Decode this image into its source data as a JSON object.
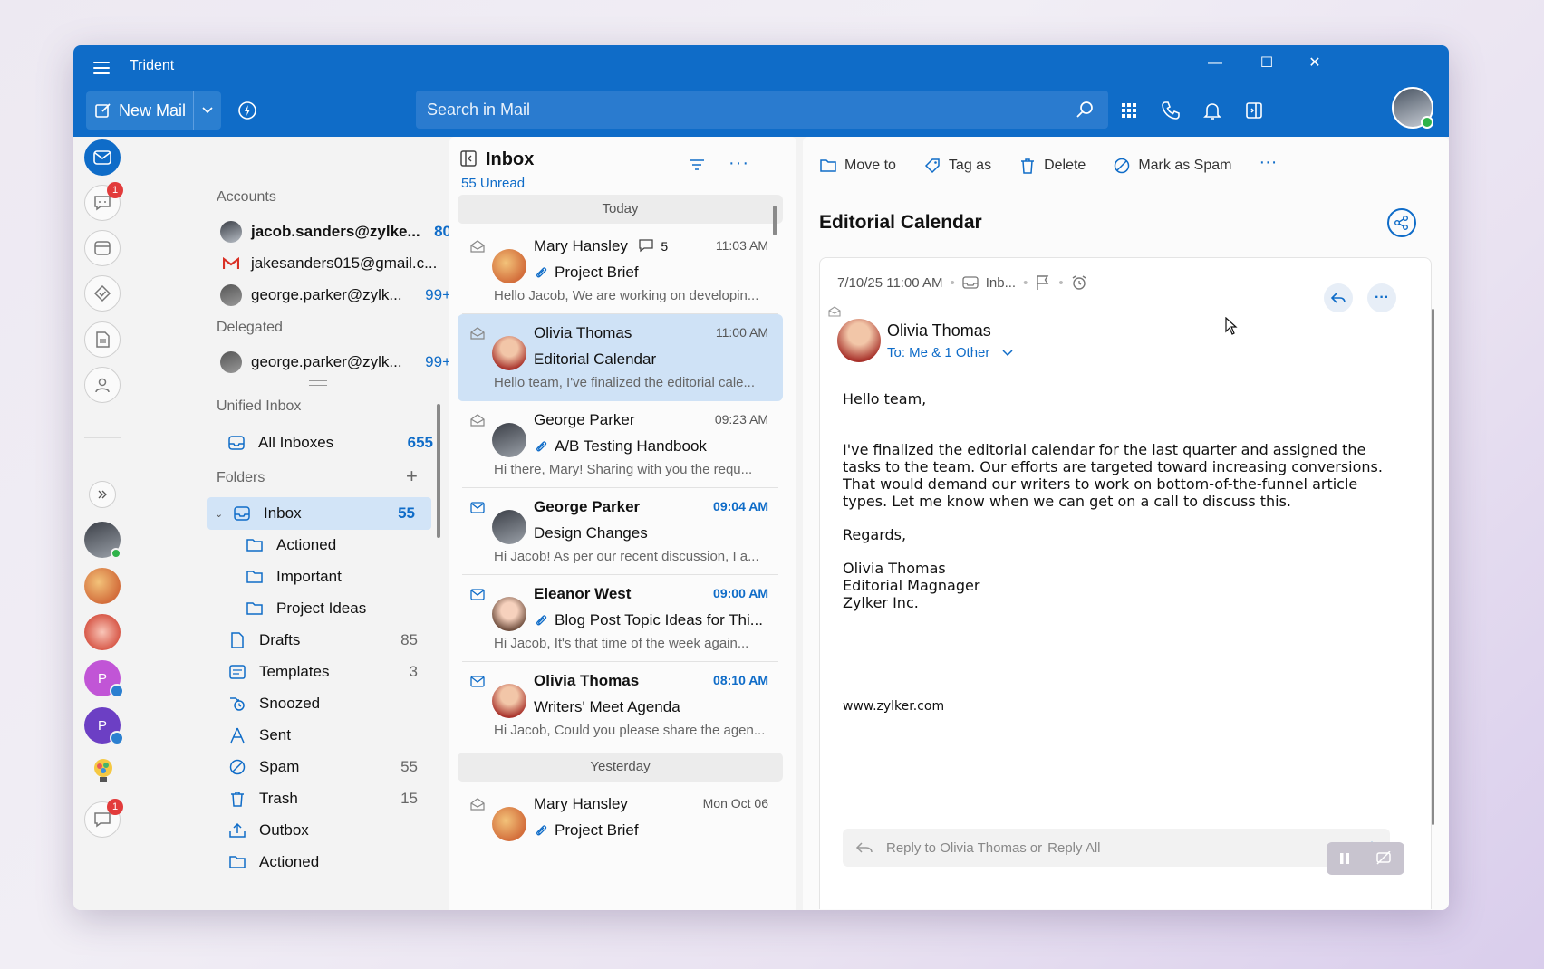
{
  "app": {
    "title": "Trident"
  },
  "toolbar": {
    "new_mail": "New Mail",
    "search_placeholder": "Search in Mail"
  },
  "rail": {
    "chat_badge": "1",
    "bottom_badge": "1",
    "letter_p1": "P",
    "letter_p2": "P"
  },
  "accounts": {
    "label": "Accounts",
    "items": [
      {
        "name": "jacob.sanders@zylke...",
        "count": "80"
      },
      {
        "name": "jakesanders015@gmail.c...",
        "count": ""
      },
      {
        "name": "george.parker@zylk...",
        "count": "99+"
      }
    ],
    "delegated_label": "Delegated",
    "delegated": [
      {
        "name": "george.parker@zylk...",
        "count": "99+"
      }
    ]
  },
  "unified": {
    "label": "Unified Inbox",
    "all_inboxes": "All Inboxes",
    "all_count": "655"
  },
  "folders": {
    "label": "Folders",
    "items": [
      {
        "name": "Inbox",
        "count": "55"
      },
      {
        "name": "Actioned",
        "count": ""
      },
      {
        "name": "Important",
        "count": ""
      },
      {
        "name": "Project Ideas",
        "count": ""
      },
      {
        "name": "Drafts",
        "count": "85"
      },
      {
        "name": "Templates",
        "count": "3"
      },
      {
        "name": "Snoozed",
        "count": ""
      },
      {
        "name": "Sent",
        "count": ""
      },
      {
        "name": "Spam",
        "count": "55"
      },
      {
        "name": "Trash",
        "count": "15"
      },
      {
        "name": "Outbox",
        "count": ""
      },
      {
        "name": "Actioned",
        "count": ""
      }
    ]
  },
  "list": {
    "title": "Inbox",
    "unread": "55 Unread",
    "group_today": "Today",
    "group_yesterday": "Yesterday",
    "messages": [
      {
        "sender": "Mary Hansley",
        "thread": "5",
        "time": "11:03 AM",
        "subject": "Project Brief",
        "preview": "Hello Jacob, We are working on developin..."
      },
      {
        "sender": "Olivia Thomas",
        "time": "11:00 AM",
        "subject": "Editorial Calendar",
        "preview": "Hello team, I've finalized the editorial cale..."
      },
      {
        "sender": "George Parker",
        "time": "09:23 AM",
        "subject": "A/B Testing Handbook",
        "preview": "Hi there, Mary! Sharing with you the requ..."
      },
      {
        "sender": "George Parker",
        "time": "09:04 AM",
        "subject": "Design Changes",
        "preview": "Hi Jacob! As per our recent discussion, I a..."
      },
      {
        "sender": "Eleanor West",
        "time": "09:00 AM",
        "subject": "Blog Post Topic Ideas for Thi...",
        "preview": "Hi Jacob, It's that time of the week again..."
      },
      {
        "sender": "Olivia Thomas",
        "time": "08:10 AM",
        "subject": "Writers' Meet Agenda",
        "preview": "Hi Jacob, Could you please share the agen..."
      },
      {
        "sender": "Mary Hansley",
        "time": "Mon Oct 06",
        "subject": "Project Brief",
        "preview": ""
      }
    ]
  },
  "reading": {
    "actions": {
      "move": "Move to",
      "tag": "Tag as",
      "delete": "Delete",
      "spam": "Mark as Spam"
    },
    "subject": "Editorial Calendar",
    "date": "7/10/25 11:00 AM",
    "folder": "Inb...",
    "from": "Olivia Thomas",
    "to": "To: Me & 1 Other",
    "body": {
      "greeting": "Hello team,",
      "p1": "I've finalized the editorial calendar for the last quarter and assigned the",
      "p2": "tasks to the team. Our efforts are targeted toward increasing conversions.",
      "p3": "That would demand our writers to work on bottom-of-the-funnel article",
      "p4": "types. Let me know when we can get on a call to discuss this.",
      "regards": "Regards,",
      "sig1": "Olivia Thomas",
      "sig2": "Editorial Magnager",
      "sig3": "Zylker Inc.",
      "url": "www.zylker.com"
    },
    "reply_to": "Reply to Olivia Thomas",
    "reply_or": "or",
    "reply_all": "Reply All"
  },
  "colors": {
    "accent": "#0f6cc8",
    "selected": "#cfe2f6",
    "badge": "#e23b3b"
  }
}
